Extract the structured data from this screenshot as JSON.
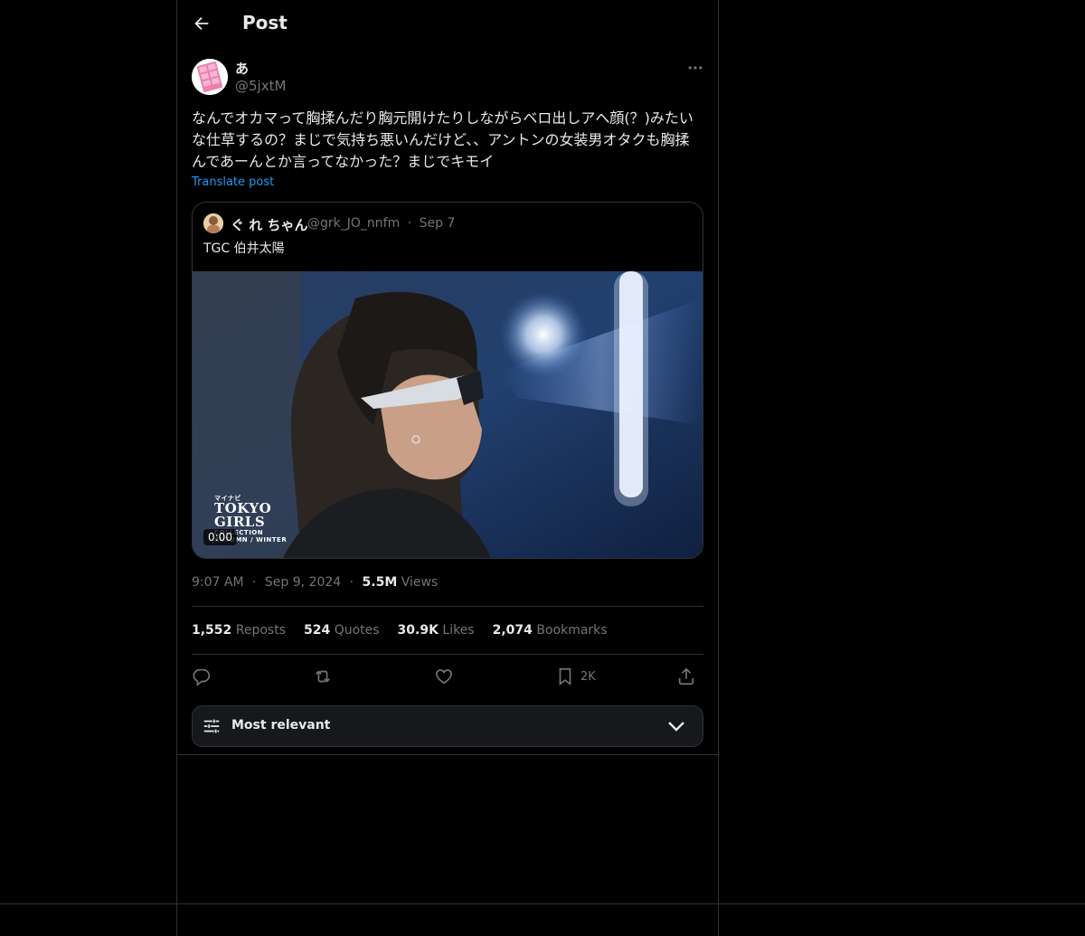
{
  "header": {
    "title": "Post",
    "back_icon": "arrow-left-icon"
  },
  "post": {
    "author_name": "あ",
    "author_handle": "@5jxtM",
    "text": "なんでオカマって胸揉んだり胸元開けたりしながらベロ出しアへ顔(？)みたいな仕草するの？まじで気持ち悪いんだけど、、アントンの女装男オタクも胸揉んであーんとか言ってなかった？まじでキモイ",
    "translate_label": "Translate post",
    "time": "9:07 AM",
    "date": "Sep 9, 2024",
    "views_count": "5.5M",
    "views_label": "Views"
  },
  "quote": {
    "name": "ぐ れ ちゃん",
    "handle": "@grk_JO_nnfm",
    "dot": "·",
    "date": "Sep 7",
    "text": "TGC 伯井太陽",
    "video_time": "0:00",
    "watermark": [
      "マイナビ",
      "TOKYO",
      "GIRLS",
      "COLLECTION",
      "AUTUMN / WINTER"
    ]
  },
  "stats": {
    "reposts_count": "1,552",
    "reposts_label": "Reposts",
    "quotes_count": "524",
    "quotes_label": "Quotes",
    "likes_count": "30.9K",
    "likes_label": "Likes",
    "bookmarks_count": "2,074",
    "bookmarks_label": "Bookmarks"
  },
  "actions": {
    "reply_icon": "reply-icon",
    "repost_icon": "repost-icon",
    "like_icon": "heart-icon",
    "bookmark_icon": "bookmark-icon",
    "bookmark_count": "2K",
    "share_icon": "share-icon"
  },
  "sort": {
    "label": "Most relevant"
  },
  "colors": {
    "background": "#000000",
    "border": "#2f3336",
    "accent": "#1d9bf0",
    "muted": "#71767b",
    "text": "#e7e9ea"
  }
}
